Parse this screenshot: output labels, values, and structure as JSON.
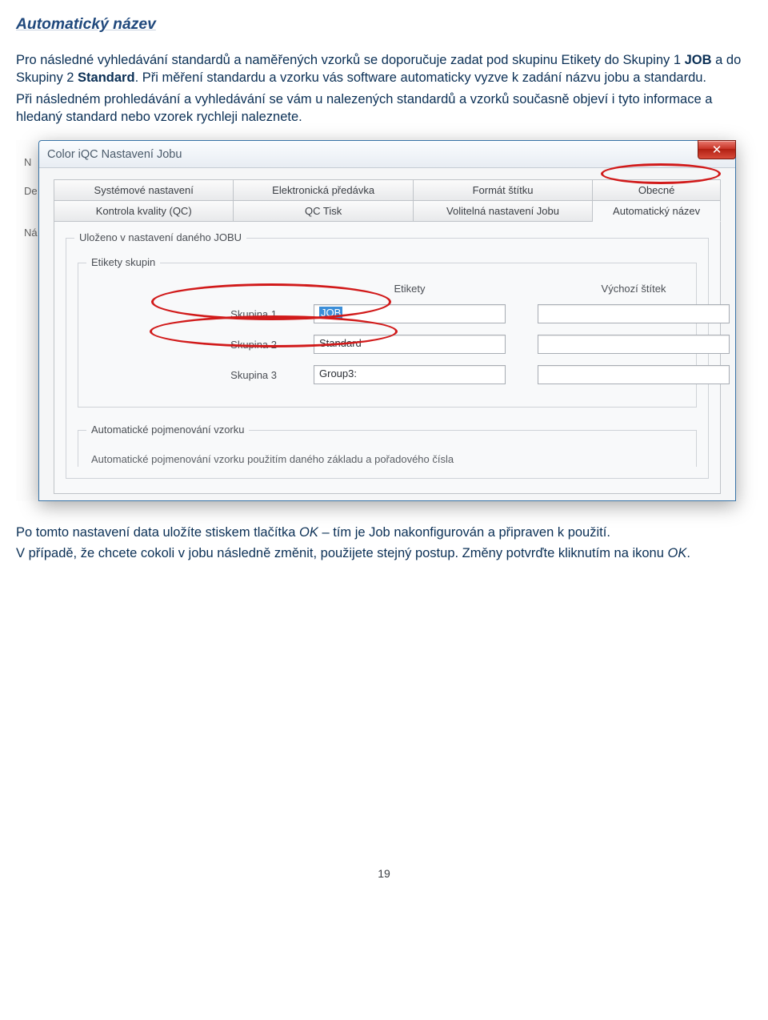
{
  "doc": {
    "title": "Automatický název",
    "p1a": "Pro následné vyhledávání standardů a naměřených vzorků se doporučuje zadat pod skupinu Etikety do Skupiny 1 ",
    "p1b_bold": "JOB",
    "p1c": " a do Skupiny 2 ",
    "p1d_bold": "Standard",
    "p1e": ". Při měření standardu a vzorku vás software automaticky vyzve k zadání názvu jobu a standardu.",
    "p2": "Při následném prohledávání a vyhledávání se vám u nalezených standardů a vzorků současně objeví i tyto informace a hledaný standard nebo vzorek rychleji naleznete.",
    "after1a": "Po tomto nastavení data uložíte stiskem tlačítka ",
    "after1b_it": "OK",
    "after1c": " – tím je Job nakonfigurován a připraven k použití.",
    "after2a": "V případě, že chcete cokoli v jobu následně změnit, použijete stejný postup. Změny potvrďte kliknutím na ikonu ",
    "after2b_it": "OK",
    "after2c": ".",
    "page_number": "19"
  },
  "peek": {
    "n": "N",
    "de": "De",
    "na": "Ná"
  },
  "dialog": {
    "title": "Color iQC Nastavení Jobu",
    "tabs_row1": {
      "t1": "Systémové nastavení",
      "t2": "Elektronická předávka",
      "t3": "Formát štítku",
      "t4": "Obecné"
    },
    "tabs_row2": {
      "t1": "Kontrola kvality (QC)",
      "t2": "QC Tisk",
      "t3": "Volitelná nastavení Jobu",
      "t4": "Automatický název"
    },
    "fs_main_legend": "Uloženo v nastavení daného JOBU",
    "fs_groups_legend": "Etikety skupin",
    "col_etikety": "Etikety",
    "col_stitek": "Výchozí štítek",
    "rows": {
      "r1": {
        "label": "Skupina 1",
        "val": "JOB"
      },
      "r2": {
        "label": "Skupina 2",
        "val": "Standard"
      },
      "r3": {
        "label": "Skupina 3",
        "val": "Group3:"
      }
    },
    "fs_auto_legend": "Automatické pojmenování vzorku",
    "auto_line": "Automatické pojmenování vzorku použitím daného základu a pořadového čísla"
  }
}
